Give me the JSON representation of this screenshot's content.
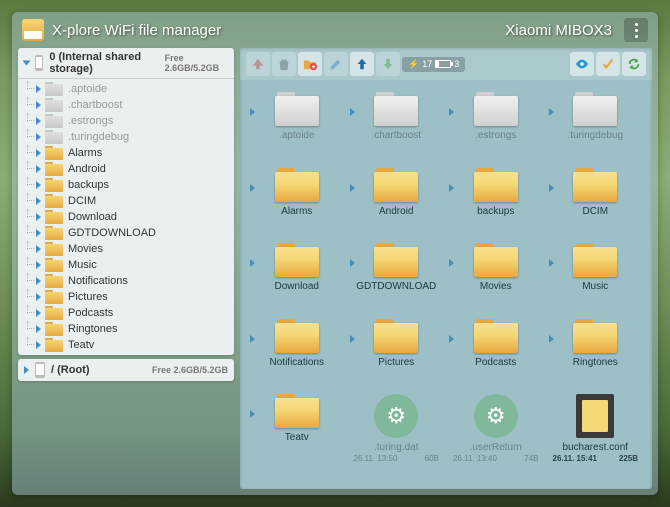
{
  "app": {
    "title": "X-plore WiFi file manager",
    "device": "Xiaomi MIBOX3"
  },
  "storage": {
    "name": "0 (Internal shared storage)",
    "free": "Free 2.6GB/5.2GB"
  },
  "root": {
    "name": "/ (Root)",
    "free": "Free 2.6GB/5.2GB"
  },
  "battery": {
    "charge": "17",
    "count": "3"
  },
  "tree": [
    {
      "name": ".aptoide",
      "hidden": true
    },
    {
      "name": ".chartboost",
      "hidden": true
    },
    {
      "name": ".estrongs",
      "hidden": true
    },
    {
      "name": ".turingdebug",
      "hidden": true
    },
    {
      "name": "Alarms",
      "hidden": false
    },
    {
      "name": "Android",
      "hidden": false
    },
    {
      "name": "backups",
      "hidden": false
    },
    {
      "name": "DCIM",
      "hidden": false
    },
    {
      "name": "Download",
      "hidden": false
    },
    {
      "name": "GDTDOWNLOAD",
      "hidden": false
    },
    {
      "name": "Movies",
      "hidden": false
    },
    {
      "name": "Music",
      "hidden": false
    },
    {
      "name": "Notifications",
      "hidden": false
    },
    {
      "name": "Pictures",
      "hidden": false
    },
    {
      "name": "Podcasts",
      "hidden": false
    },
    {
      "name": "Ringtones",
      "hidden": false
    },
    {
      "name": "Teatv",
      "hidden": false
    }
  ],
  "grid": [
    {
      "name": ".aptoide",
      "type": "folder",
      "hidden": true
    },
    {
      "name": ".chartboost",
      "type": "folder",
      "hidden": true
    },
    {
      "name": ".estrongs",
      "type": "folder",
      "hidden": true
    },
    {
      "name": ".turingdebug",
      "type": "folder",
      "hidden": true
    },
    {
      "name": "Alarms",
      "type": "folder",
      "hidden": false
    },
    {
      "name": "Android",
      "type": "folder",
      "hidden": false
    },
    {
      "name": "backups",
      "type": "folder",
      "hidden": false
    },
    {
      "name": "DCIM",
      "type": "folder",
      "hidden": false
    },
    {
      "name": "Download",
      "type": "folder",
      "hidden": false
    },
    {
      "name": "GDTDOWNLOAD",
      "type": "folder",
      "hidden": false
    },
    {
      "name": "Movies",
      "type": "folder",
      "hidden": false
    },
    {
      "name": "Music",
      "type": "folder",
      "hidden": false
    },
    {
      "name": "Notifications",
      "type": "folder",
      "hidden": false
    },
    {
      "name": "Pictures",
      "type": "folder",
      "hidden": false
    },
    {
      "name": "Podcasts",
      "type": "folder",
      "hidden": false
    },
    {
      "name": "Ringtones",
      "type": "folder",
      "hidden": false
    },
    {
      "name": "Teatv",
      "type": "folder",
      "hidden": false
    },
    {
      "name": ".turing.dat",
      "type": "config",
      "hidden": true,
      "date": "26.11. 13:50",
      "size": "60B"
    },
    {
      "name": ".userReturn",
      "type": "config",
      "hidden": true,
      "date": "26.11. 13:40",
      "size": "74B"
    },
    {
      "name": "bucharest.conf",
      "type": "file",
      "hidden": false,
      "date": "26.11. 15:41",
      "size": "225B"
    }
  ]
}
